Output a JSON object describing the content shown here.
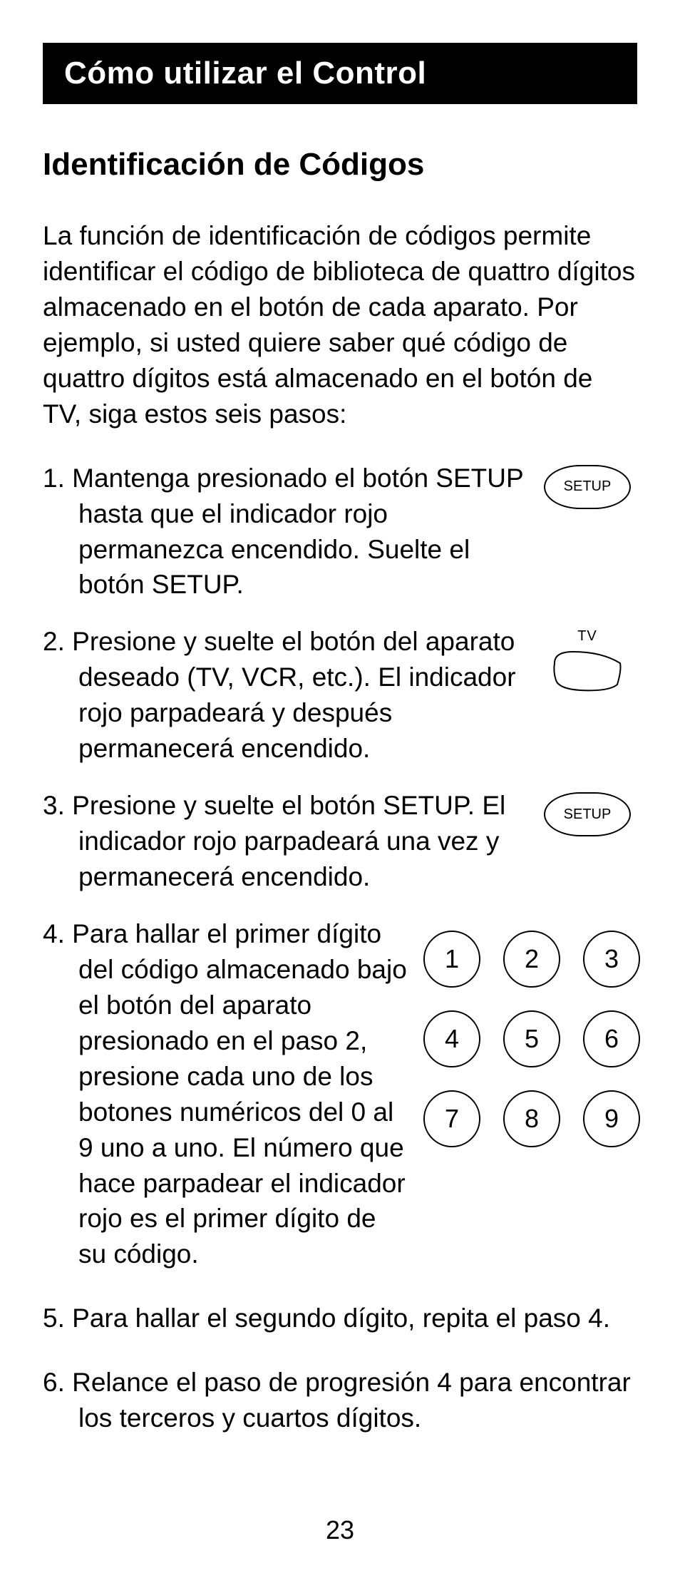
{
  "titleBar": "Cómo utilizar el Control",
  "sectionHeading": "Identificación de Códigos",
  "intro": "La función de identificación de códigos permite identificar el código de biblioteca de quattro dígitos almacenado en el botón de cada aparato. Por ejemplo, si usted quiere saber qué código de quattro dígitos está almacenado en el botón de TV, siga estos seis pasos:",
  "steps": {
    "s1": "1. Mantenga presionado el botón SETUP hasta que el indicador rojo permanezca encendido. Suelte el botón SETUP.",
    "s2": "2.  Presione y suelte el botón del aparato deseado (TV, VCR, etc.). El indicador rojo parpadeará y después permanecerá encendido.",
    "s3": "3.  Presione y suelte el botón SETUP. El indicador rojo parpadeará una vez y permanecerá encendido.",
    "s4": "4.  Para hallar el primer dígito del código almacenado bajo el botón del aparato presionado en el paso 2, presione cada uno de los botones numéricos del 0 al 9 uno a uno. El número que hace parpadear el indicador rojo es el primer dígito de su código.",
    "s5": "5.  Para hallar el segundo dígito, repita el paso 4.",
    "s6": "6. Relance el paso de progresión 4 para encontrar los terceros y cuartos dígitos."
  },
  "buttons": {
    "setup": "SETUP",
    "tvLabel": "TV"
  },
  "keypad": [
    "1",
    "2",
    "3",
    "4",
    "5",
    "6",
    "7",
    "8",
    "9"
  ],
  "pageNumber": "23"
}
